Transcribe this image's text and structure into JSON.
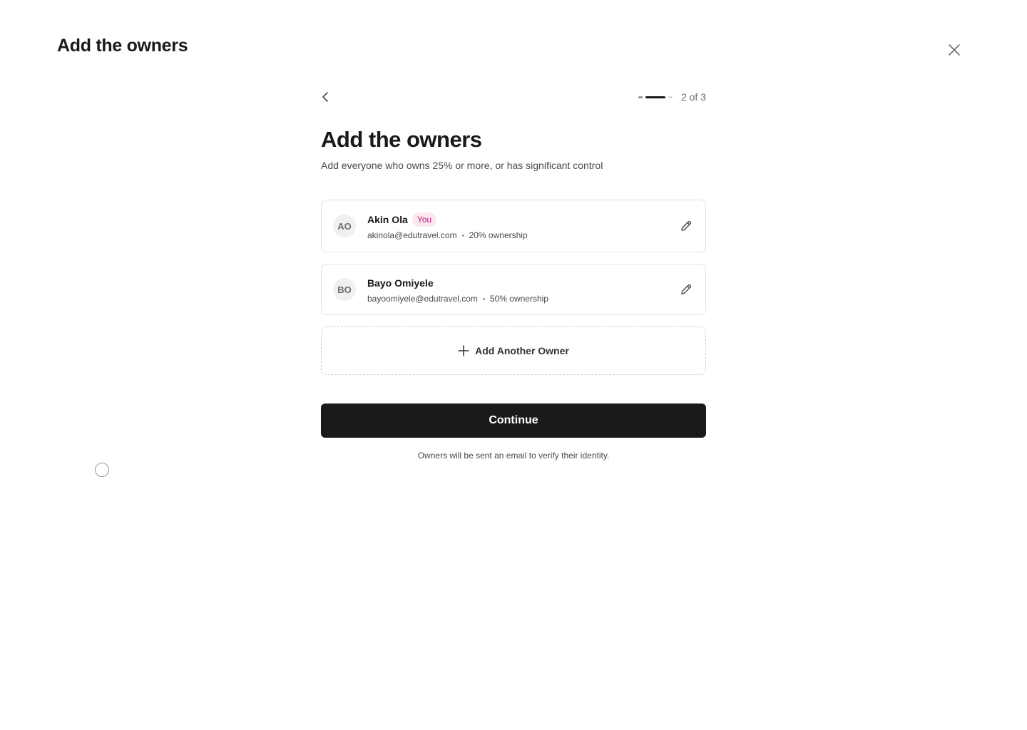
{
  "header": {
    "title": "Add the owners"
  },
  "icons": {
    "close": "close-icon",
    "back": "chevron-left-icon",
    "edit": "pencil-icon",
    "add": "plus-icon"
  },
  "stepper": {
    "current": 2,
    "total": 3,
    "label": "2 of 3"
  },
  "main": {
    "title": "Add the owners",
    "subtitle": "Add everyone who owns 25% or more, or has significant control"
  },
  "owners": [
    {
      "initials": "AO",
      "name": "Akin Ola",
      "badge": "You",
      "email": "akinola@edutravel.com",
      "ownership": "20% ownership"
    },
    {
      "initials": "BO",
      "name": "Bayo Omiyele",
      "email": "bayoomiyele@edutravel.com",
      "ownership": "50% ownership"
    }
  ],
  "add_owner": {
    "label": "Add Another Owner"
  },
  "continue": {
    "label": "Continue"
  },
  "footnote": "Owners will be sent an email to verify their identity.",
  "colors": {
    "primary": "#1a1a1a",
    "badge_text": "#c2187a",
    "badge_bg": "#fce8f3",
    "border": "#e2e2e2"
  }
}
